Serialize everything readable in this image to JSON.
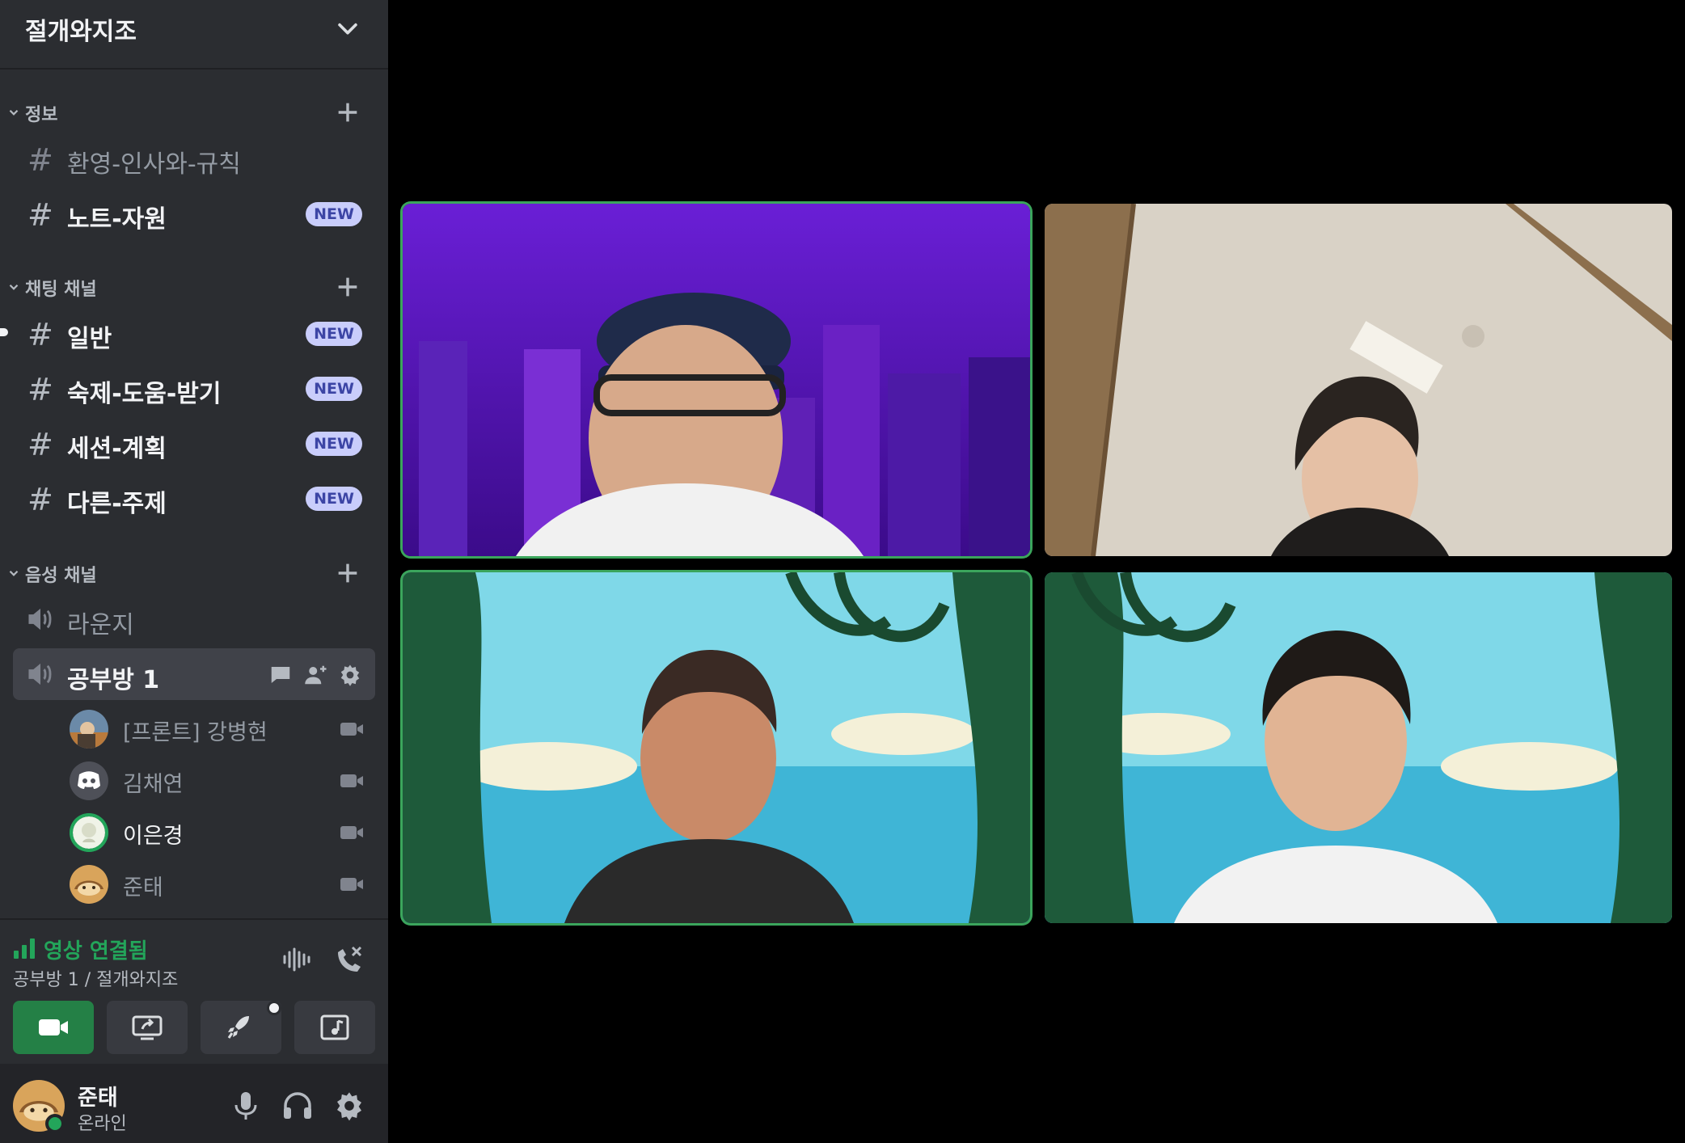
{
  "server": {
    "name": "절개와지조"
  },
  "categories": [
    {
      "label": "정보"
    },
    {
      "label": "채팅 채널"
    },
    {
      "label": "음성 채널"
    }
  ],
  "text_channels": [
    {
      "label": "환영-인사와-규칙",
      "badge": ""
    },
    {
      "label": "노트-자원",
      "badge": "NEW"
    },
    {
      "label": "일반",
      "badge": "NEW"
    },
    {
      "label": "숙제-도움-받기",
      "badge": "NEW"
    },
    {
      "label": "세션-계획",
      "badge": "NEW"
    },
    {
      "label": "다른-주제",
      "badge": "NEW"
    }
  ],
  "voice_channels": [
    {
      "label": "라운지"
    },
    {
      "label": "공부방 1"
    }
  ],
  "voice_members": [
    {
      "name": "[프론트] 강병현"
    },
    {
      "name": "김채연"
    },
    {
      "name": "이은경"
    },
    {
      "name": "준태"
    }
  ],
  "voice_panel": {
    "status": "영상 연결됨",
    "location": "공부방 1 / 절개와지조"
  },
  "user": {
    "name": "준태",
    "status": "온라인"
  },
  "video_tiles": [
    {
      "participant": "video-tile-1",
      "speaking": true
    },
    {
      "participant": "video-tile-2",
      "speaking": false
    },
    {
      "participant": "video-tile-3",
      "speaking": true
    },
    {
      "participant": "video-tile-4",
      "speaking": false
    }
  ],
  "colors": {
    "sidebar_bg": "#2b2d31",
    "active_channel_bg": "#404249",
    "connected_green": "#23a55a",
    "new_badge_bg": "#c9cdfb",
    "new_badge_text": "#3c45a5"
  },
  "icons": [
    "chevron-down-icon",
    "plus-icon",
    "hash-icon",
    "speaker-icon",
    "chat-icon",
    "add-member-icon",
    "gear-icon",
    "camera-icon",
    "signal-icon",
    "noise-suppression-icon",
    "disconnect-icon",
    "screen-share-icon",
    "activity-rocket-icon",
    "soundboard-icon",
    "microphone-icon",
    "headphones-icon"
  ]
}
